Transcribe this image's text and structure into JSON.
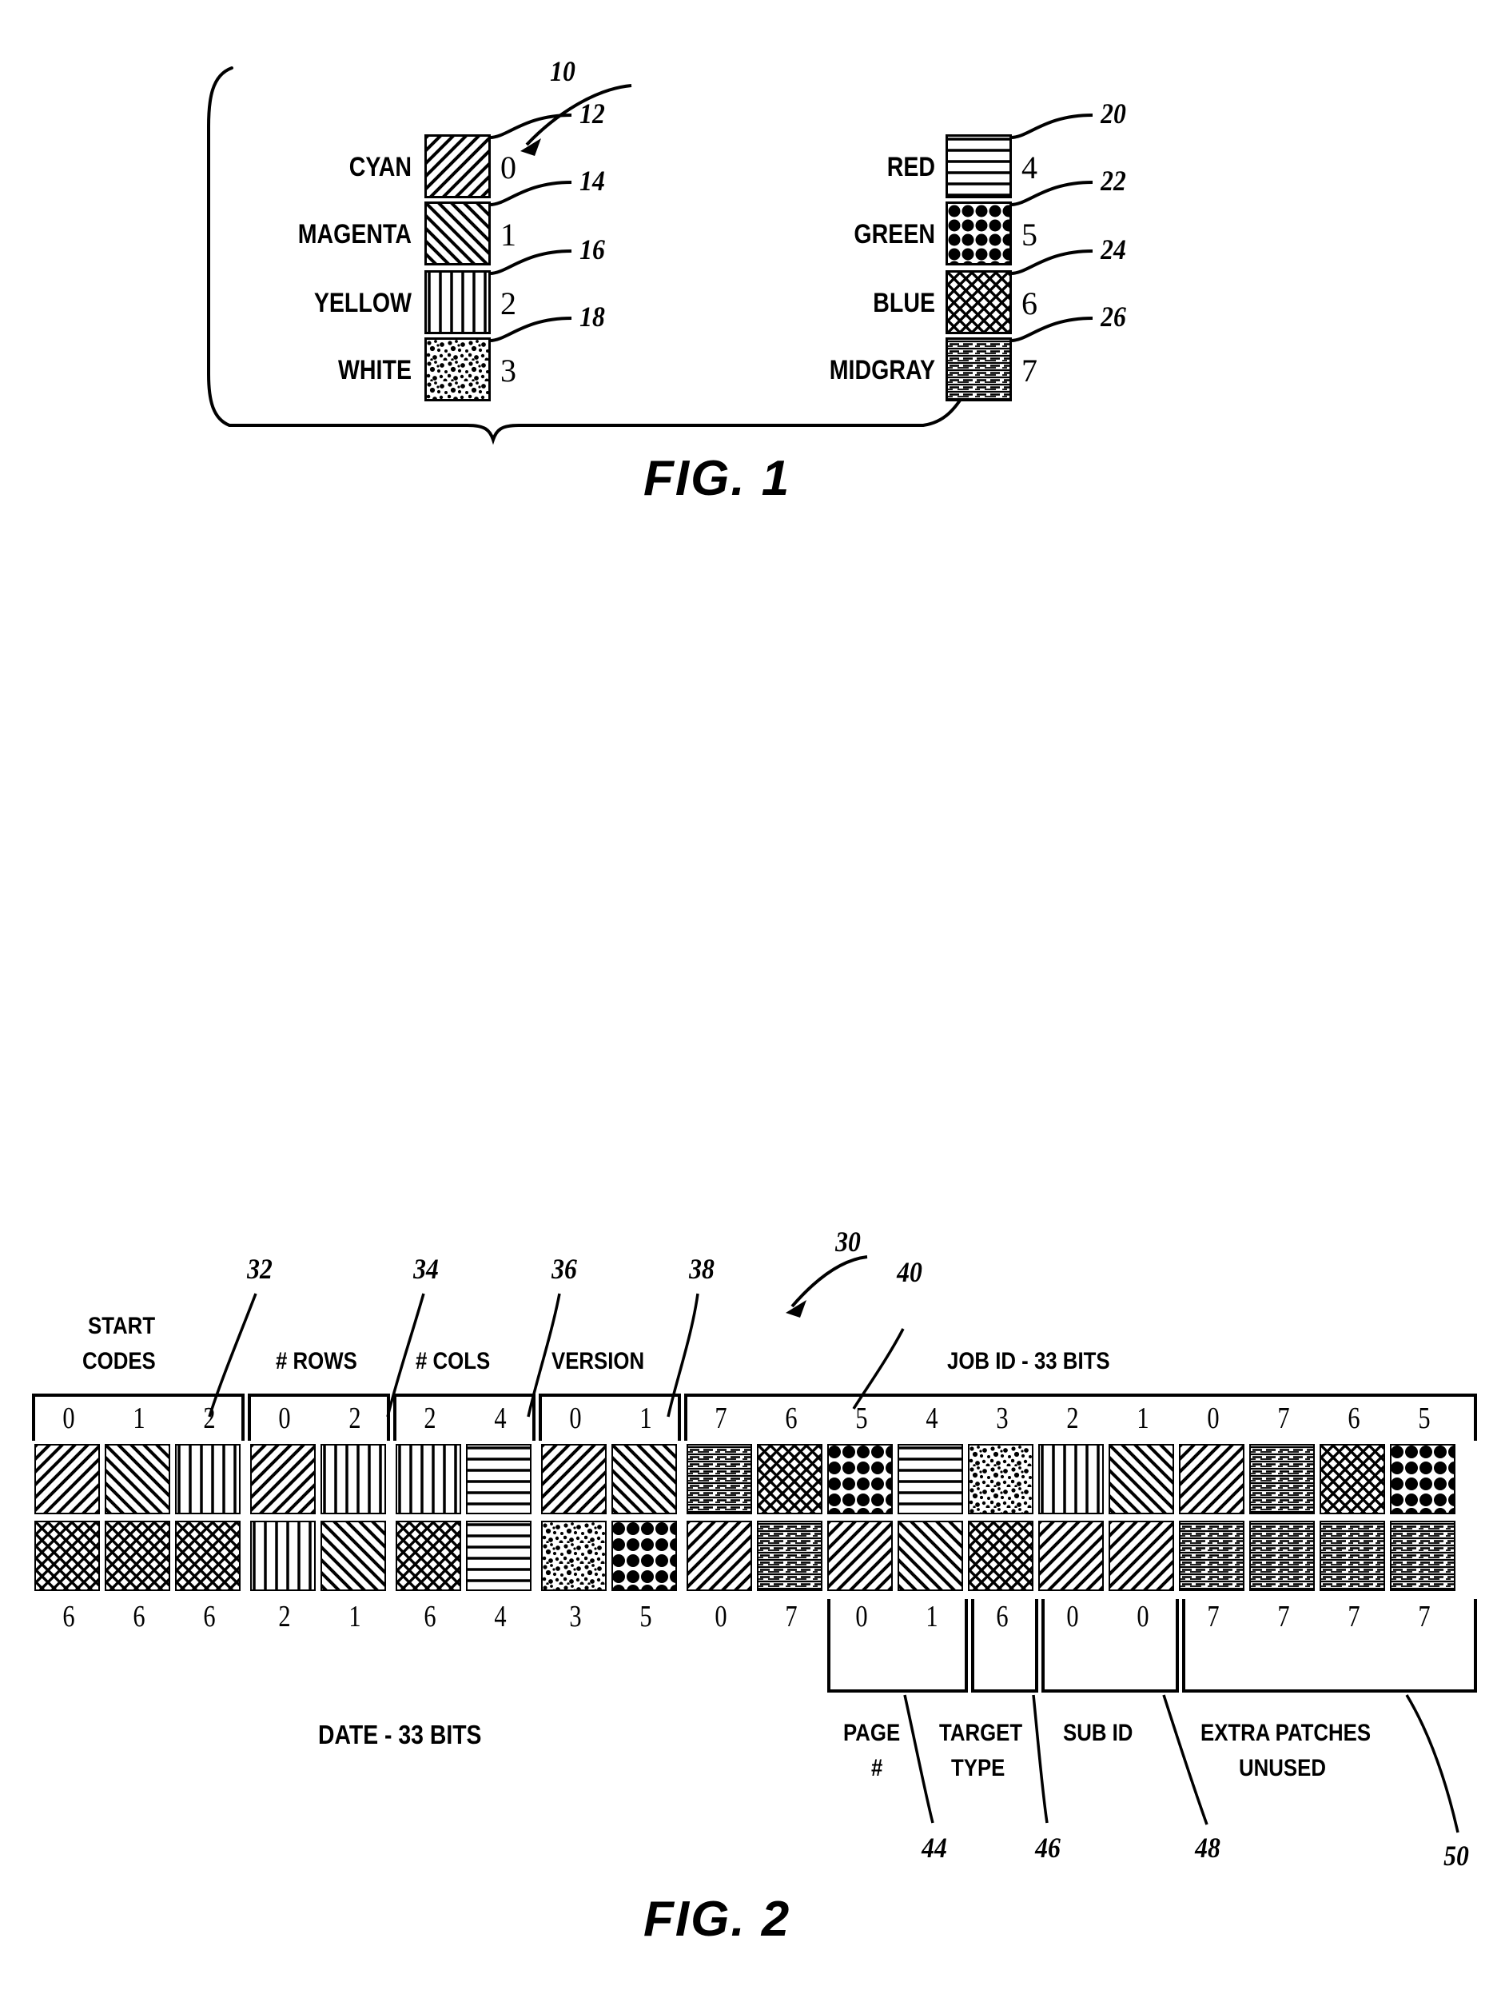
{
  "figure1": {
    "caption": "FIG. 1",
    "group_ref": "10",
    "left_column": [
      {
        "name": "CYAN",
        "code": "0",
        "ref": "12",
        "pattern": "diag-back"
      },
      {
        "name": "MAGENTA",
        "code": "1",
        "ref": "14",
        "pattern": "diag-fwd"
      },
      {
        "name": "YELLOW",
        "code": "2",
        "ref": "16",
        "pattern": "vertical"
      },
      {
        "name": "WHITE",
        "code": "3",
        "ref": "18",
        "pattern": "speckle"
      }
    ],
    "right_column": [
      {
        "name": "RED",
        "code": "4",
        "ref": "20",
        "pattern": "horizontal"
      },
      {
        "name": "GREEN",
        "code": "5",
        "ref": "22",
        "pattern": "bigdots"
      },
      {
        "name": "BLUE",
        "code": "6",
        "ref": "24",
        "pattern": "crosshatch"
      },
      {
        "name": "MIDGRAY",
        "code": "7",
        "ref": "26",
        "pattern": "finedash"
      }
    ]
  },
  "figure2": {
    "caption": "FIG. 2",
    "group_ref": "30",
    "top_fields": [
      {
        "label": "START\nCODES",
        "ref": "32",
        "span": 3
      },
      {
        "label": "# ROWS",
        "ref": "34",
        "span": 2
      },
      {
        "label": "# COLS",
        "ref": "36",
        "span": 2
      },
      {
        "label": "VERSION",
        "ref": "38",
        "span": 2
      },
      {
        "label": "JOB ID - 33 BITS",
        "ref": "40",
        "span": 11
      }
    ],
    "top_field_labels": {
      "start_codes_l1": "START",
      "start_codes_l2": "CODES",
      "rows": "# ROWS",
      "cols": "# COLS",
      "version": "VERSION",
      "jobid": "JOB ID - 33 BITS"
    },
    "top_refs": [
      "32",
      "34",
      "36",
      "38",
      "40"
    ],
    "arrow_ref": "30",
    "top_values": [
      "0",
      "1",
      "2",
      "0",
      "2",
      "2",
      "4",
      "0",
      "1",
      "7",
      "6",
      "5",
      "4",
      "3",
      "2",
      "1",
      "0",
      "7",
      "6",
      "5"
    ],
    "top_patterns": [
      "diag-back",
      "diag-fwd",
      "vertical",
      "diag-back",
      "vertical",
      "vertical",
      "horizontal",
      "diag-back",
      "diag-fwd",
      "finedash",
      "crosshatch",
      "bigdots",
      "horizontal",
      "speckle",
      "vertical",
      "diag-fwd",
      "diag-back",
      "finedash",
      "crosshatch",
      "bigdots"
    ],
    "bottom_values": [
      "6",
      "6",
      "6",
      "2",
      "1",
      "6",
      "4",
      "3",
      "5",
      "0",
      "7",
      "0",
      "1",
      "6",
      "0",
      "0",
      "7",
      "7",
      "7",
      "7"
    ],
    "bottom_patterns": [
      "crosshatch",
      "crosshatch",
      "crosshatch",
      "vertical",
      "diag-fwd",
      "crosshatch",
      "horizontal",
      "speckle",
      "bigdots",
      "diag-back",
      "finedash",
      "diag-back",
      "diag-fwd",
      "crosshatch",
      "diag-back",
      "diag-back",
      "finedash",
      "finedash",
      "finedash",
      "finedash"
    ],
    "bottom_fields": {
      "date": "DATE - 33 BITS",
      "page_l1": "PAGE",
      "page_l2": "#",
      "target_l1": "TARGET",
      "target_l2": "TYPE",
      "subid": "SUB ID",
      "extra_l1": "EXTRA PATCHES",
      "extra_l2": "UNUSED"
    },
    "bottom_refs": [
      "44",
      "46",
      "48",
      "50"
    ]
  },
  "patterns": {
    "diag-back": "diagonal-backslash-hatch",
    "diag-fwd": "diagonal-forwardslash-hatch",
    "vertical": "vertical-line-hatch",
    "speckle": "fine-random-dots",
    "horizontal": "horizontal-line-hatch",
    "bigdots": "large-dot-grid-on-black",
    "crosshatch": "diamond-crosshatch",
    "finedash": "fine-horizontal-dashes"
  },
  "colors": {
    "ink": "#000000",
    "paper": "#ffffff"
  }
}
